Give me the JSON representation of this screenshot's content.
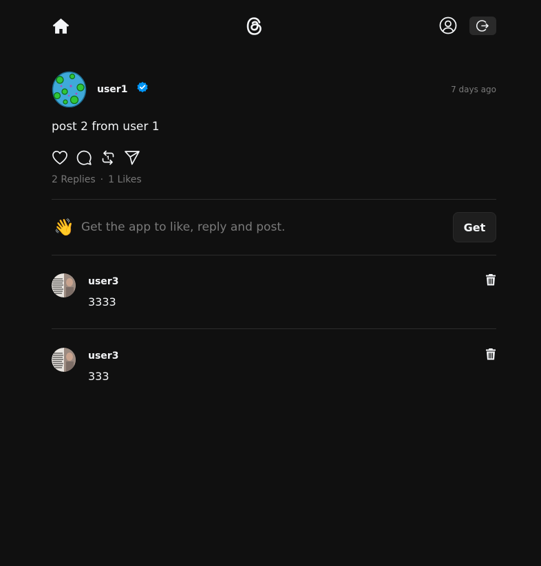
{
  "header": {
    "home_icon": "home-icon",
    "logo_icon": "threads-logo-icon",
    "profile_icon": "user-circle-icon",
    "logout_icon": "logout-icon"
  },
  "post": {
    "username": "user1",
    "verified": true,
    "time_ago": "7 days ago",
    "text": "post 2 from user 1",
    "replies_label": "2 Replies",
    "separator": "·",
    "likes_label": "1 Likes",
    "actions": [
      "heart-icon",
      "comment-icon",
      "repost-icon",
      "share-icon"
    ]
  },
  "get_app": {
    "emoji": "👋",
    "text": "Get the app to like, reply and post.",
    "button_label": "Get"
  },
  "replies": [
    {
      "username": "user3",
      "text": "3333"
    },
    {
      "username": "user3",
      "text": "333"
    }
  ],
  "colors": {
    "background": "#101010",
    "text": "#f3f5f7",
    "muted": "#777777",
    "verified": "#0095f6",
    "divider": "#2d2d2d"
  }
}
